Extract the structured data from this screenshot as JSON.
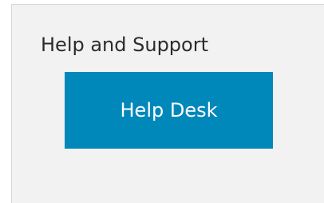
{
  "help_panel": {
    "title": "Help and Support",
    "button_label": "Help Desk",
    "button_color": "#0088bb",
    "background_color": "#f2f2f2"
  }
}
